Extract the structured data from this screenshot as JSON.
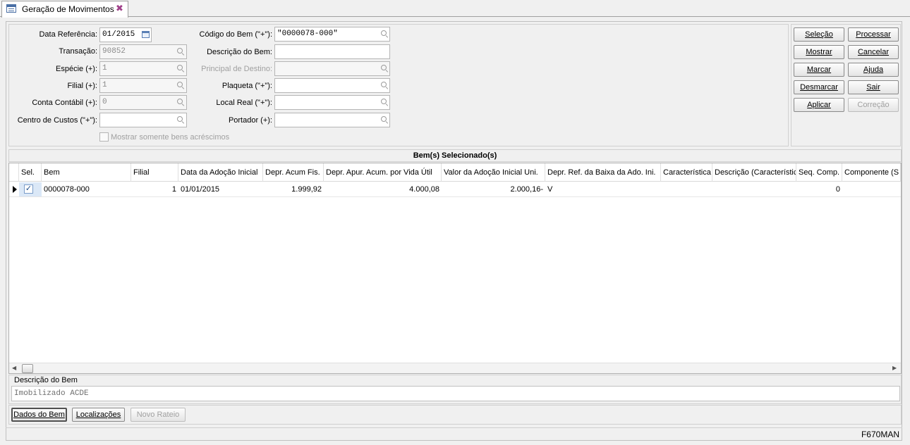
{
  "window": {
    "tab_title": "Geração de Movimentos",
    "program_code": "F670MAN"
  },
  "form": {
    "data_referencia": {
      "label": "Data Referência:",
      "value": "01/2015"
    },
    "transacao": {
      "label": "Transação:",
      "value": "90852"
    },
    "especie": {
      "label": "Espécie (+):",
      "value": "1"
    },
    "filial": {
      "label": "Filial (+):",
      "value": "1"
    },
    "conta_contabil": {
      "label": "Conta Contábil (+):",
      "value": "0"
    },
    "centro_custos": {
      "label": "Centro de Custos (\"+\"):",
      "value": ""
    },
    "codigo_bem": {
      "label": "Código do Bem (\"+\"):",
      "value": "\"0000078-000\""
    },
    "descricao_bem": {
      "label": "Descrição do Bem:",
      "value": ""
    },
    "principal_destino": {
      "label": "Principal de Destino:",
      "value": ""
    },
    "plaqueta": {
      "label": "Plaqueta (\"+\"):",
      "value": ""
    },
    "local_real": {
      "label": "Local Real (\"+\"):",
      "value": ""
    },
    "portador": {
      "label": "Portador (+):",
      "value": ""
    },
    "mostrar_acrescimos": {
      "label": "Mostrar somente bens acréscimos",
      "checked": false
    }
  },
  "actions": {
    "selecao": "Seleção",
    "processar": "Processar",
    "mostrar": "Mostrar",
    "cancelar": "Cancelar",
    "marcar": "Marcar",
    "ajuda": "Ajuda",
    "desmarcar": "Desmarcar",
    "sair": "Sair",
    "aplicar": "Aplicar",
    "correcao": "Correção"
  },
  "grid": {
    "title": "Bem(s) Selecionado(s)",
    "columns": [
      "Sel.",
      "Bem",
      "Filial",
      "Data da Adoção Inicial",
      "Depr. Acum Fis.",
      "Depr. Apur. Acum. por Vida Útil",
      "Valor da Adoção Inicial Uni.",
      "Depr. Ref. da Baixa da Ado. Ini.",
      "Característica",
      "Descrição (Característic",
      "Seq. Comp.",
      "Componente (S"
    ],
    "rows": [
      {
        "sel": true,
        "bem": "0000078-000",
        "filial": "1",
        "data_adocao": "01/01/2015",
        "depr_acum_fis": "1.999,92",
        "depr_apur_acum": "4.000,08",
        "valor_adocao": "2.000,16-",
        "depr_ref_baixa": "V",
        "caracteristica": "",
        "descricao_caract": "",
        "seq_comp": "0",
        "componente": ""
      }
    ]
  },
  "descricao": {
    "label": "Descrição do Bem",
    "value": "Imobilizado ACDE"
  },
  "bottom_buttons": {
    "dados_bem": "Dados do Bem",
    "localizacoes": "Localizações",
    "novo_rateio": "Novo Rateio"
  }
}
